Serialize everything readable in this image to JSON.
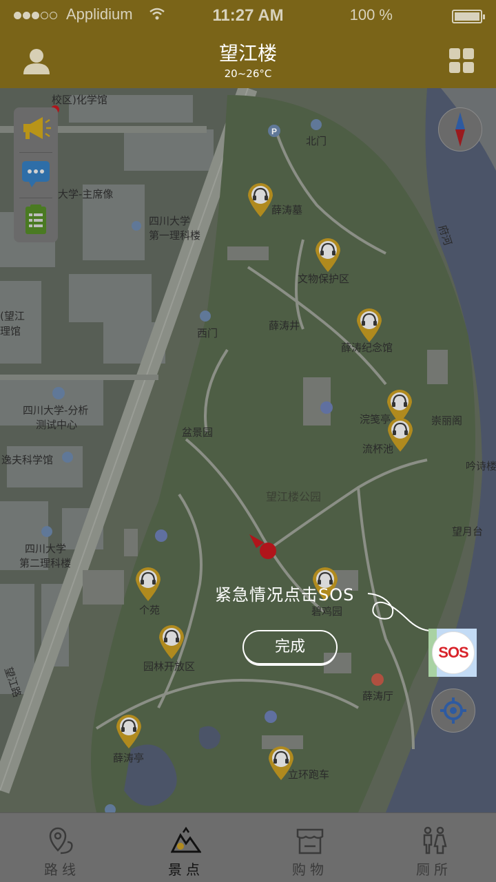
{
  "status_bar": {
    "carrier": "Applidium",
    "time": "11:27 AM",
    "battery": "100 %"
  },
  "header": {
    "title": "望江楼",
    "temperature": "20~26°C"
  },
  "map": {
    "labels": [
      {
        "text": "校区)化学馆"
      },
      {
        "text": "北门"
      },
      {
        "text": "薛涛墓"
      },
      {
        "text": "大学-主席像"
      },
      {
        "text": "四川大学"
      },
      {
        "text": "第一理科楼"
      },
      {
        "text": "文物保护区"
      },
      {
        "text": "(望江"
      },
      {
        "text": "理馆"
      },
      {
        "text": "薛涛井"
      },
      {
        "text": "西门"
      },
      {
        "text": "薛涛纪念馆"
      },
      {
        "text": "四川大学-分析"
      },
      {
        "text": "测试中心"
      },
      {
        "text": "浣笺亭"
      },
      {
        "text": "崇丽阁"
      },
      {
        "text": "盆景园"
      },
      {
        "text": "流杯池"
      },
      {
        "text": "逸夫科学馆"
      },
      {
        "text": "吟诗楼"
      },
      {
        "text": "望江楼公园"
      },
      {
        "text": "望月台"
      },
      {
        "text": "四川大学"
      },
      {
        "text": "第二理科楼"
      },
      {
        "text": "个苑"
      },
      {
        "text": "碧鸡园"
      },
      {
        "text": "园林开放区"
      },
      {
        "text": "薛涛厅"
      },
      {
        "text": "薛涛亭"
      },
      {
        "text": "立环跑车"
      },
      {
        "text": "望江路"
      },
      {
        "text": "府河"
      }
    ]
  },
  "overlay": {
    "hint": "紧急情况点击SOS",
    "done_label": "完成",
    "sos_label": "SOS"
  },
  "icons": {
    "user": "user-icon",
    "grid": "grid-menu-icon",
    "compass": "compass-icon",
    "locate": "locate-icon",
    "broadcast": "megaphone-icon",
    "chat": "chat-icon",
    "guide": "notes-icon",
    "audio_pin": "audio-guide-pin-icon"
  },
  "tabbar": {
    "tabs": [
      {
        "label": "路线",
        "icon": "route-icon"
      },
      {
        "label": "景点",
        "icon": "scenic-icon",
        "active": true
      },
      {
        "label": "购物",
        "icon": "shop-icon"
      },
      {
        "label": "厕所",
        "icon": "toilet-icon"
      }
    ]
  },
  "colors": {
    "header": "#7a6418",
    "sos": "#d8232a",
    "tab_active": "#111111"
  }
}
